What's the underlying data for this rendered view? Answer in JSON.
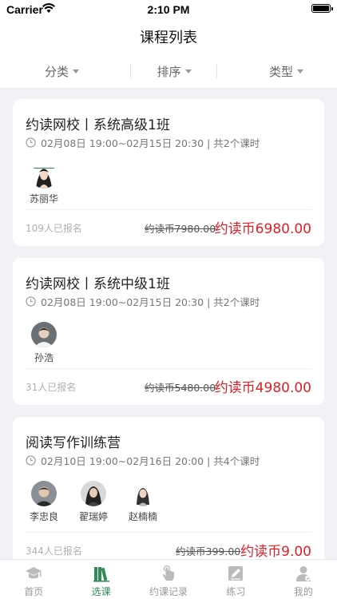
{
  "status_bar": {
    "carrier": "Carrier",
    "time": "2:10 PM"
  },
  "header": {
    "title": "课程列表"
  },
  "filters": [
    {
      "label": "分类"
    },
    {
      "label": "排序"
    },
    {
      "label": "类型"
    }
  ],
  "courses": [
    {
      "title": "约读网校丨系统高级1班",
      "time": "02月08日 19:00~02月15日 20:30 | 共2个课时",
      "teachers": [
        {
          "name": "苏丽华"
        }
      ],
      "enrolled": "109人已报名",
      "original_price": "约读币7980.00",
      "price": "约读币6980.00"
    },
    {
      "title": "约读网校丨系统中级1班",
      "time": "02月08日 19:00~02月15日 20:30 | 共2个课时",
      "teachers": [
        {
          "name": "孙浩"
        }
      ],
      "enrolled": "31人已报名",
      "original_price": "约读币5480.00",
      "price": "约读币4980.00"
    },
    {
      "title": "阅读写作训练营",
      "time": "02月10日 19:00~02月16日 20:00 | 共4个课时",
      "teachers": [
        {
          "name": "李忠良"
        },
        {
          "name": "翟瑞婷"
        },
        {
          "name": "赵楠楠"
        }
      ],
      "enrolled": "344人已报名",
      "original_price": "约读币399.00",
      "price": "约读币9.00"
    }
  ],
  "tabs": [
    {
      "label": "首页",
      "icon": "graduation-cap-icon",
      "active": false
    },
    {
      "label": "选课",
      "icon": "books-icon",
      "active": true
    },
    {
      "label": "约课记录",
      "icon": "hand-pointer-icon",
      "active": false
    },
    {
      "label": "练习",
      "icon": "pencil-note-icon",
      "active": false
    },
    {
      "label": "我的",
      "icon": "user-icon",
      "active": false
    }
  ],
  "colors": {
    "accent": "#2e8b57",
    "price": "#e31e24",
    "background": "#f2f2f6"
  }
}
